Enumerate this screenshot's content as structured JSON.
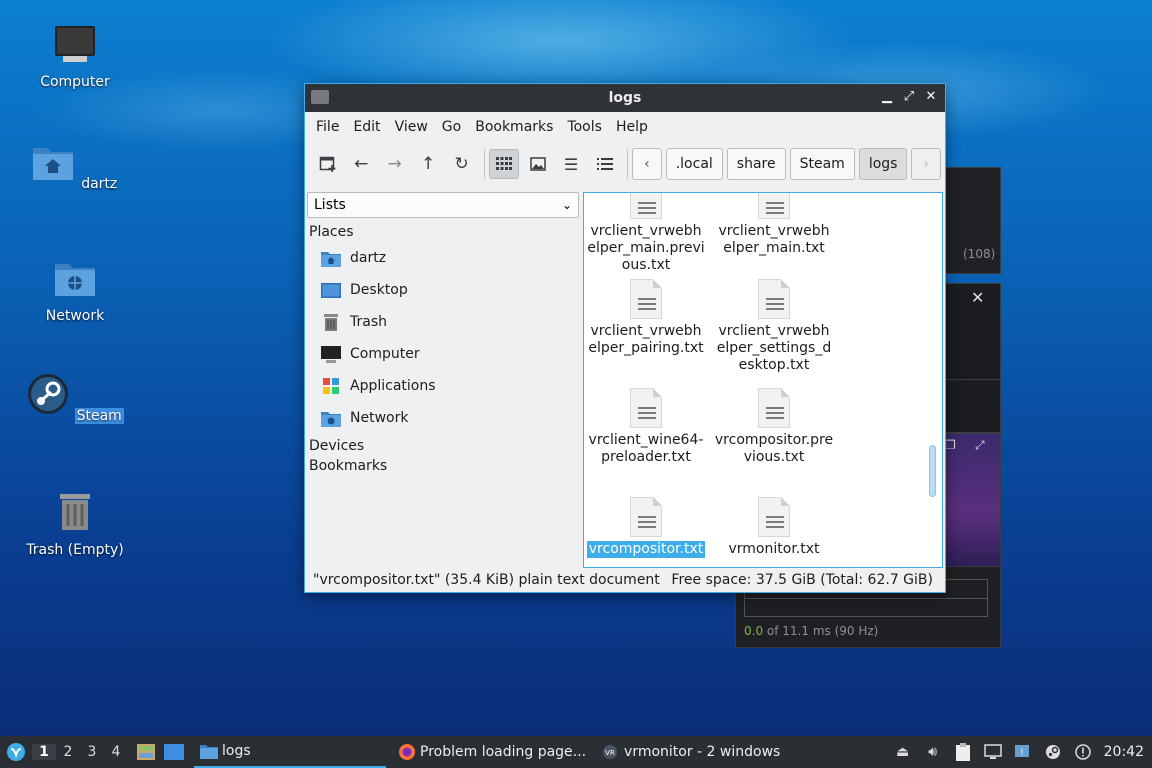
{
  "desktop": {
    "icons": [
      {
        "label": "Computer"
      },
      {
        "label": "dartz"
      },
      {
        "label": "Network"
      },
      {
        "label": "Steam"
      },
      {
        "label": "Trash (Empty)"
      }
    ]
  },
  "background_windows": {
    "count_text": "(108)",
    "timing_value": "0.0",
    "timing_rest": " of 11.1 ms (90 Hz)"
  },
  "file_manager": {
    "title": "logs",
    "menu": [
      "File",
      "Edit",
      "View",
      "Go",
      "Bookmarks",
      "Tools",
      "Help"
    ],
    "breadcrumbs": [
      ".local",
      "share",
      "Steam",
      "logs"
    ],
    "side_combo": "Lists",
    "sections": {
      "places": "Places",
      "devices": "Devices",
      "bookmarks": "Bookmarks"
    },
    "places": [
      {
        "label": "dartz",
        "icon": "home-folder-icon"
      },
      {
        "label": "Desktop",
        "icon": "desktop-icon"
      },
      {
        "label": "Trash",
        "icon": "trash-icon"
      },
      {
        "label": "Computer",
        "icon": "computer-icon"
      },
      {
        "label": "Applications",
        "icon": "applications-icon"
      },
      {
        "label": "Network",
        "icon": "network-icon"
      }
    ],
    "files": [
      {
        "name": "vrclient_vrwebhelper_main.previous.txt",
        "lines": [
          "vrclient_vrwebh",
          "elper_main.previ",
          "ous.txt"
        ]
      },
      {
        "name": "vrclient_vrwebhelper_main.txt",
        "lines": [
          "vrclient_vrwebh",
          "elper_main.txt"
        ]
      },
      {
        "name": "vrclient_vrwebhelper_pairing.txt",
        "lines": [
          "vrclient_vrwebh",
          "elper_pairing.txt"
        ]
      },
      {
        "name": "vrclient_vrwebhelper_settings_desktop.txt",
        "lines": [
          "vrclient_vrwebh",
          "elper_settings_d",
          "esktop.txt"
        ]
      },
      {
        "name": "vrclient_wine64-preloader.txt",
        "lines": [
          "vrclient_wine64-",
          "preloader.txt"
        ]
      },
      {
        "name": "vrcompositor.previous.txt",
        "lines": [
          "vrcompositor.pre",
          "vious.txt"
        ]
      },
      {
        "name": "vrcompositor.txt",
        "lines": [
          "vrcompositor.txt"
        ]
      },
      {
        "name": "vrmonitor.txt",
        "lines": [
          "vrmonitor.txt"
        ]
      }
    ],
    "status_left": "\"vrcompositor.txt\" (35.4 KiB) plain text document",
    "status_right": "Free space: 37.5 GiB (Total: 62.7 GiB)"
  },
  "taskbar": {
    "workspaces": [
      "1",
      "2",
      "3",
      "4"
    ],
    "tasks": [
      {
        "label": "logs"
      },
      {
        "label": "Problem loading page..."
      },
      {
        "label": "vrmonitor - 2 windows"
      }
    ],
    "clock": "20:42"
  },
  "colors": {
    "accent": "#3daee9",
    "titlebar": "#2f3338",
    "taskbar": "#2b2f33"
  }
}
